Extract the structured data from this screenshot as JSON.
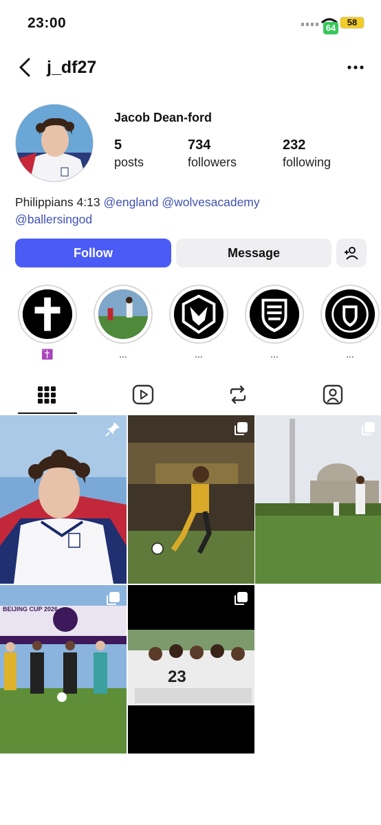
{
  "status": {
    "time": "23:00",
    "network_badge": "64",
    "battery": "58"
  },
  "header": {
    "username": "j_df27"
  },
  "profile": {
    "display_name": "Jacob Dean-ford",
    "stats": [
      {
        "value": "5",
        "label": "posts"
      },
      {
        "value": "734",
        "label": "followers"
      },
      {
        "value": "232",
        "label": "following"
      }
    ],
    "bio_text": "Philippians 4:13",
    "mentions": [
      "@england",
      "@wolvesacademy",
      "@ballersingod"
    ]
  },
  "actions": {
    "follow_label": "Follow",
    "message_label": "Message"
  },
  "highlights": [
    {
      "label": "✝️",
      "icon": "cross-icon"
    },
    {
      "label": "...",
      "icon": "football-photo"
    },
    {
      "label": "...",
      "icon": "wolves-logo"
    },
    {
      "label": "...",
      "icon": "england-badge"
    },
    {
      "label": "...",
      "icon": "scotland-badge"
    }
  ],
  "tabs": [
    "grid-icon",
    "reels-icon",
    "reposts-icon",
    "tagged-icon"
  ],
  "posts": [
    {
      "kind": "pinned",
      "icon": "pin-icon"
    },
    {
      "kind": "carousel",
      "icon": "carousel-icon"
    },
    {
      "kind": "carousel",
      "icon": "carousel-icon"
    },
    {
      "kind": "carousel",
      "icon": "carousel-icon",
      "banner_text": "BEIJING CUP 2026"
    },
    {
      "kind": "carousel",
      "icon": "carousel-icon",
      "shirt_number": "23"
    }
  ],
  "colors": {
    "accent": "#4a5cf5",
    "mention": "#3f51b5",
    "button_bg": "#efeff2"
  }
}
